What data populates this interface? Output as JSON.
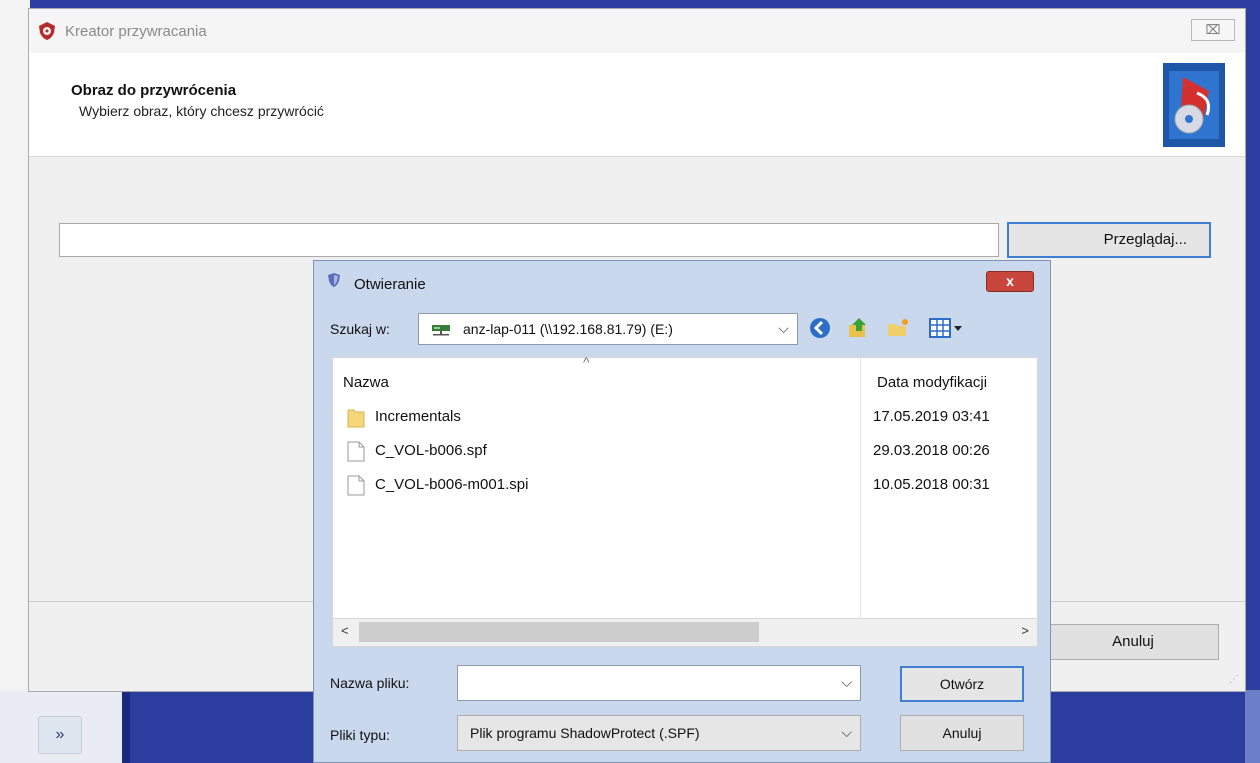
{
  "wizard": {
    "title": "Kreator przywracania",
    "close_glyph": "⌧",
    "header_title": "Obraz do przywrócenia",
    "header_subtitle": "Wybierz obraz, który chcesz przywrócić",
    "header_icon": "restore-disk-icon",
    "path_value": "",
    "browse_label": "Przeglądaj...",
    "cancel_label": "Anuluj"
  },
  "dialog": {
    "title": "Otwieranie",
    "close_glyph": "x",
    "look_in_label": "Szukaj w:",
    "look_in_value": "anz-lap-011 (\\\\192.168.81.79) (E:)",
    "toolbar": [
      "back-icon",
      "up-folder-icon",
      "new-folder-icon",
      "view-menu-icon"
    ],
    "columns": {
      "name": "Nazwa",
      "date": "Data modyfikacji"
    },
    "files": [
      {
        "name": "Incrementals",
        "date": "17.05.2019 03:41",
        "icon": "folder-icon"
      },
      {
        "name": "C_VOL-b006.spf",
        "date": "29.03.2018 00:26",
        "icon": "file-icon"
      },
      {
        "name": "C_VOL-b006-m001.spi",
        "date": "10.05.2018 00:31",
        "icon": "file-icon"
      }
    ],
    "file_name_label": "Nazwa pliku:",
    "file_name_value": "",
    "file_type_label": "Pliki typu:",
    "file_type_value": "Plik programu ShadowProtect (.SPF)",
    "open_label": "Otwórz",
    "cancel_label": "Anuluj"
  },
  "taskbar": {
    "expand_glyph": "»"
  },
  "colors": {
    "accent": "#3c7fd3",
    "close_red": "#c9463d",
    "desktop": "#2b3ea0"
  }
}
